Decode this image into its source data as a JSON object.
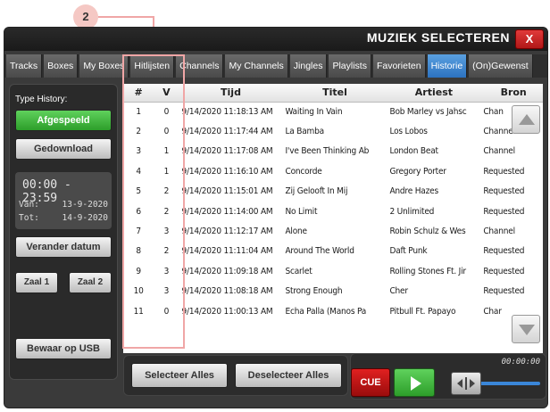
{
  "window": {
    "title": "MUZIEK SELECTEREN",
    "close_label": "X"
  },
  "callout": {
    "number": "2"
  },
  "tabs": [
    {
      "label": "Tracks",
      "active": false
    },
    {
      "label": "Boxes",
      "active": false
    },
    {
      "label": "My Boxes",
      "active": false
    },
    {
      "label": "Hitlijsten",
      "active": false
    },
    {
      "label": "Channels",
      "active": false
    },
    {
      "label": "My Channels",
      "active": false
    },
    {
      "label": "Jingles",
      "active": false
    },
    {
      "label": "Playlists",
      "active": false
    },
    {
      "label": "Favorieten",
      "active": false
    },
    {
      "label": "Historie",
      "active": true
    },
    {
      "label": "(On)Gewenst",
      "active": false
    }
  ],
  "sidebar": {
    "type_label": "Type History:",
    "played_button": "Afgespeeld",
    "downloaded_button": "Gedownload",
    "time_range": "00:00  -  23:59",
    "from_label": "Van:",
    "from_value": "13-9-2020",
    "to_label": "Tot:",
    "to_value": "14-9-2020",
    "change_date_button": "Verander datum",
    "zaal1_button": "Zaal 1",
    "zaal2_button": "Zaal 2",
    "save_usb_button": "Bewaar op USB"
  },
  "table": {
    "columns": [
      "#",
      "V",
      "Tijd",
      "Titel",
      "Artiest",
      "Bron"
    ],
    "rows": [
      [
        "1",
        "0",
        "9/14/2020 11:18:13 AM",
        "Waiting In Vain",
        "Bob Marley vs Jahsc",
        "Chan"
      ],
      [
        "2",
        "0",
        "9/14/2020 11:17:44 AM",
        "La Bamba",
        "Los Lobos",
        "Channel"
      ],
      [
        "3",
        "1",
        "9/14/2020 11:17:08 AM",
        "I've Been Thinking Ab",
        "London Beat",
        "Channel"
      ],
      [
        "4",
        "1",
        "9/14/2020 11:16:10 AM",
        "Concorde",
        "Gregory Porter",
        "Requested"
      ],
      [
        "5",
        "2",
        "9/14/2020 11:15:01 AM",
        "Zij Gelooft In Mij",
        "Andre Hazes",
        "Requested"
      ],
      [
        "6",
        "2",
        "9/14/2020 11:14:00 AM",
        "No Limit",
        "2 Unlimited",
        "Requested"
      ],
      [
        "7",
        "3",
        "9/14/2020 11:12:17 AM",
        "Alone",
        "Robin Schulz & Wes",
        "Channel"
      ],
      [
        "8",
        "2",
        "9/14/2020 11:11:04 AM",
        "Around The World",
        "Daft Punk",
        "Requested"
      ],
      [
        "9",
        "3",
        "9/14/2020 11:09:18 AM",
        "Scarlet",
        "Rolling Stones Ft. Jir",
        "Requested"
      ],
      [
        "10",
        "3",
        "9/14/2020 11:08:18 AM",
        "Strong Enough",
        "Cher",
        "Requested"
      ],
      [
        "11",
        "0",
        "9/14/2020 11:00:13 AM",
        "Echa Palla (Manos Pa",
        "Pitbull Ft. Papayo",
        "Char"
      ]
    ]
  },
  "bottom": {
    "select_all": "Selecteer Alles",
    "deselect_all": "Deselecteer Alles"
  },
  "player": {
    "cue_label": "CUE",
    "time": "00:00:00"
  },
  "icons": {
    "scroll_up": "triangle-up-icon",
    "scroll_down": "triangle-down-icon",
    "play": "play-icon",
    "slider": "slider-thumb-icon"
  },
  "colors": {
    "active_tab": "#2c72c0",
    "green_button": "#2d9e2a",
    "cue_red": "#c01414",
    "callout_pink": "#f0a6a6"
  }
}
